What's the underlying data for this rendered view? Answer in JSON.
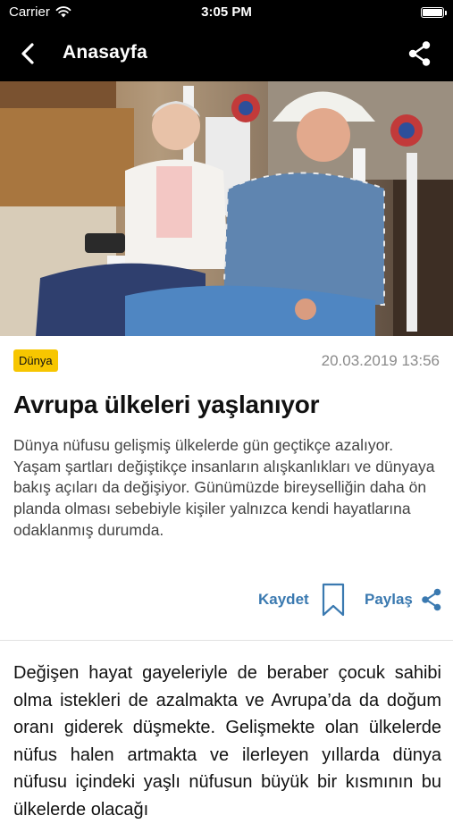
{
  "status_bar": {
    "carrier": "Carrier",
    "time": "3:05 PM"
  },
  "nav": {
    "title": "Anasayfa"
  },
  "hero": {
    "alt": ""
  },
  "article": {
    "category": "Dünya",
    "date": "20.03.2019 13:56",
    "headline": "Avrupa ülkeleri yaşlanıyor",
    "summary": "Dünya nüfusu gelişmiş ülkelerde gün geçtikçe azalıyor. Yaşam şartları değiştikçe insanların alışkanlıkları ve dünyaya bakış açıları da değişiyor. Günümüzde bireyselliğin daha ön planda olması sebebiyle kişiler yalnızca kendi hayatlarına odaklanmış durumda.",
    "body": "Değişen hayat gayeleriyle de beraber çocuk sahibi olma istekleri de azalmakta ve Avrupa’da da doğum oranı giderek düşmekte. Gelişmekte olan ülkelerde nüfus halen artmakta ve ilerleyen yıllarda dünya nüfusu içindeki yaşlı nüfusun büyük bir kısmının bu ülkelerde olacağı"
  },
  "actions": {
    "save_label": "Kaydet",
    "share_label": "Paylaş"
  },
  "colors": {
    "accent": "#3a79b0",
    "badge": "#f7c600",
    "bar": "#000000"
  },
  "icons": [
    "wifi-icon",
    "battery-icon",
    "back-chevron-icon",
    "share-icon",
    "bookmark-icon"
  ]
}
